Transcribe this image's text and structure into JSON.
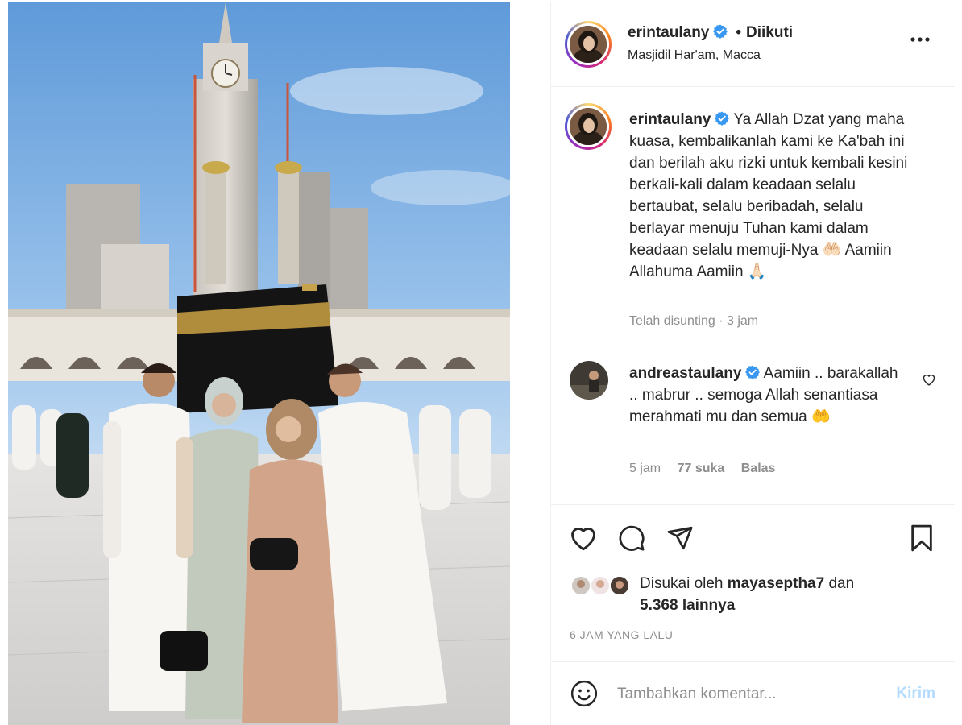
{
  "post": {
    "author": {
      "username": "erintaulany",
      "verified": true,
      "follow_state": "Diikuti",
      "location": "Masjidil Har'am, Macca"
    },
    "caption": {
      "username": "erintaulany",
      "text": "Ya Allah Dzat yang maha kuasa, kembalikanlah kami ke Ka'bah ini dan berilah aku rizki untuk kembali kesini berkali-kali dalam keadaan selalu bertaubat, selalu beribadah, selalu berlayar menuju Tuhan kami dalam keadaan selalu memuji-Nya 🤲🏻 Aamiin Allahuma Aamiin 🙏🏻",
      "edited": "Telah disunting",
      "separator": "·",
      "time": "3 jam"
    },
    "comments": [
      {
        "username": "andreastaulany",
        "verified": true,
        "text": "Aamiin .. barakallah .. mabrur .. semoga Allah senantiasa merahmati mu dan semua 🤲",
        "time": "5 jam",
        "likes": "77 suka",
        "reply_label": "Balas"
      }
    ],
    "likes": {
      "prefix": "Disukai oleh",
      "first_user": "mayaseptha7",
      "joiner": "dan",
      "others": "5.368 lainnya"
    },
    "posted_ago": "6 JAM YANG LALU"
  },
  "comment_box": {
    "placeholder": "Tambahkan komentar...",
    "post_label": "Kirim"
  },
  "icons": {
    "more": "more-horizontal-icon",
    "verified": "verified-badge-icon",
    "like": "heart-icon",
    "comment": "comment-icon",
    "share": "paper-plane-icon",
    "save": "bookmark-icon",
    "emoji": "emoji-smile-icon"
  },
  "colors": {
    "verified_blue": "#3897f0",
    "muted_text": "#8e8e8e",
    "post_button_disabled": "#b3dbff",
    "divider": "#efefef"
  }
}
